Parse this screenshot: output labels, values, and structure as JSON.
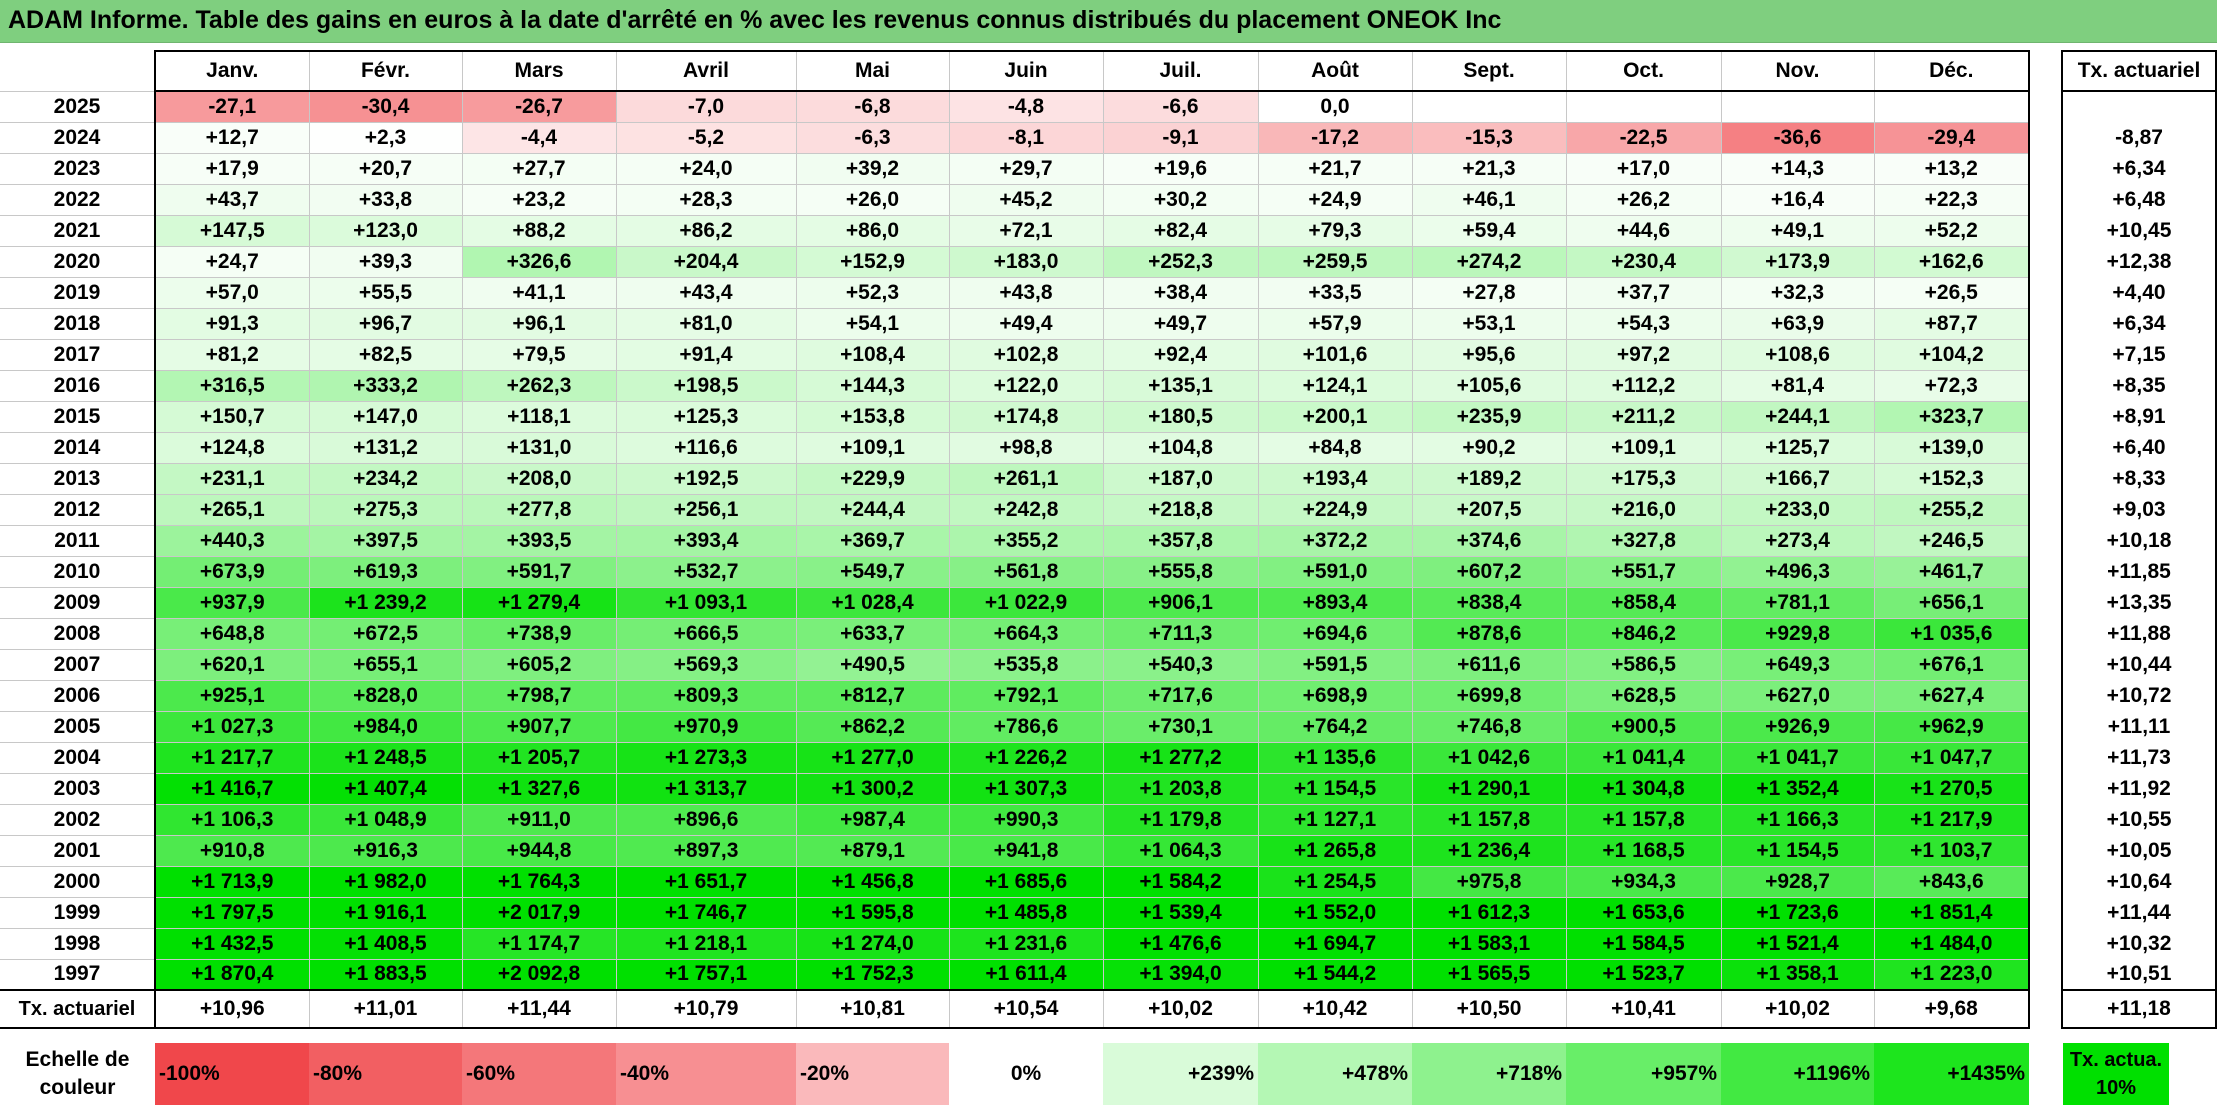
{
  "title": "ADAM Informe. Table des gains en euros à la date d'arrêté en % avec les revenus connus distribués du placement ONEOK Inc",
  "months": [
    "Janv.",
    "Févr.",
    "Mars",
    "Avril",
    "Mai",
    "Juin",
    "Juil.",
    "Août",
    "Sept.",
    "Oct.",
    "Nov.",
    "Déc."
  ],
  "tx_header": "Tx. actuariel",
  "rows": [
    {
      "year": "2025",
      "cells": [
        "-27,1",
        "-30,4",
        "-26,7",
        "-7,0",
        "-6,8",
        "-4,8",
        "-6,6",
        "0,0",
        "",
        "",
        "",
        ""
      ],
      "tx": ""
    },
    {
      "year": "2024",
      "cells": [
        "+12,7",
        "+2,3",
        "-4,4",
        "-5,2",
        "-6,3",
        "-8,1",
        "-9,1",
        "-17,2",
        "-15,3",
        "-22,5",
        "-36,6",
        "-29,4"
      ],
      "tx": "-8,87"
    },
    {
      "year": "2023",
      "cells": [
        "+17,9",
        "+20,7",
        "+27,7",
        "+24,0",
        "+39,2",
        "+29,7",
        "+19,6",
        "+21,7",
        "+21,3",
        "+17,0",
        "+14,3",
        "+13,2"
      ],
      "tx": "+6,34"
    },
    {
      "year": "2022",
      "cells": [
        "+43,7",
        "+33,8",
        "+23,2",
        "+28,3",
        "+26,0",
        "+45,2",
        "+30,2",
        "+24,9",
        "+46,1",
        "+26,2",
        "+16,4",
        "+22,3"
      ],
      "tx": "+6,48"
    },
    {
      "year": "2021",
      "cells": [
        "+147,5",
        "+123,0",
        "+88,2",
        "+86,2",
        "+86,0",
        "+72,1",
        "+82,4",
        "+79,3",
        "+59,4",
        "+44,6",
        "+49,1",
        "+52,2"
      ],
      "tx": "+10,45"
    },
    {
      "year": "2020",
      "cells": [
        "+24,7",
        "+39,3",
        "+326,6",
        "+204,4",
        "+152,9",
        "+183,0",
        "+252,3",
        "+259,5",
        "+274,2",
        "+230,4",
        "+173,9",
        "+162,6"
      ],
      "tx": "+12,38"
    },
    {
      "year": "2019",
      "cells": [
        "+57,0",
        "+55,5",
        "+41,1",
        "+43,4",
        "+52,3",
        "+43,8",
        "+38,4",
        "+33,5",
        "+27,8",
        "+37,7",
        "+32,3",
        "+26,5"
      ],
      "tx": "+4,40"
    },
    {
      "year": "2018",
      "cells": [
        "+91,3",
        "+96,7",
        "+96,1",
        "+81,0",
        "+54,1",
        "+49,4",
        "+49,7",
        "+57,9",
        "+53,1",
        "+54,3",
        "+63,9",
        "+87,7"
      ],
      "tx": "+6,34"
    },
    {
      "year": "2017",
      "cells": [
        "+81,2",
        "+82,5",
        "+79,5",
        "+91,4",
        "+108,4",
        "+102,8",
        "+92,4",
        "+101,6",
        "+95,6",
        "+97,2",
        "+108,6",
        "+104,2"
      ],
      "tx": "+7,15"
    },
    {
      "year": "2016",
      "cells": [
        "+316,5",
        "+333,2",
        "+262,3",
        "+198,5",
        "+144,3",
        "+122,0",
        "+135,1",
        "+124,1",
        "+105,6",
        "+112,2",
        "+81,4",
        "+72,3"
      ],
      "tx": "+8,35"
    },
    {
      "year": "2015",
      "cells": [
        "+150,7",
        "+147,0",
        "+118,1",
        "+125,3",
        "+153,8",
        "+174,8",
        "+180,5",
        "+200,1",
        "+235,9",
        "+211,2",
        "+244,1",
        "+323,7"
      ],
      "tx": "+8,91"
    },
    {
      "year": "2014",
      "cells": [
        "+124,8",
        "+131,2",
        "+131,0",
        "+116,6",
        "+109,1",
        "+98,8",
        "+104,8",
        "+84,8",
        "+90,2",
        "+109,1",
        "+125,7",
        "+139,0"
      ],
      "tx": "+6,40"
    },
    {
      "year": "2013",
      "cells": [
        "+231,1",
        "+234,2",
        "+208,0",
        "+192,5",
        "+229,9",
        "+261,1",
        "+187,0",
        "+193,4",
        "+189,2",
        "+175,3",
        "+166,7",
        "+152,3"
      ],
      "tx": "+8,33"
    },
    {
      "year": "2012",
      "cells": [
        "+265,1",
        "+275,3",
        "+277,8",
        "+256,1",
        "+244,4",
        "+242,8",
        "+218,8",
        "+224,9",
        "+207,5",
        "+216,0",
        "+233,0",
        "+255,2"
      ],
      "tx": "+9,03"
    },
    {
      "year": "2011",
      "cells": [
        "+440,3",
        "+397,5",
        "+393,5",
        "+393,4",
        "+369,7",
        "+355,2",
        "+357,8",
        "+372,2",
        "+374,6",
        "+327,8",
        "+273,4",
        "+246,5"
      ],
      "tx": "+10,18"
    },
    {
      "year": "2010",
      "cells": [
        "+673,9",
        "+619,3",
        "+591,7",
        "+532,7",
        "+549,7",
        "+561,8",
        "+555,8",
        "+591,0",
        "+607,2",
        "+551,7",
        "+496,3",
        "+461,7"
      ],
      "tx": "+11,85"
    },
    {
      "year": "2009",
      "cells": [
        "+937,9",
        "+1 239,2",
        "+1 279,4",
        "+1 093,1",
        "+1 028,4",
        "+1 022,9",
        "+906,1",
        "+893,4",
        "+838,4",
        "+858,4",
        "+781,1",
        "+656,1"
      ],
      "tx": "+13,35"
    },
    {
      "year": "2008",
      "cells": [
        "+648,8",
        "+672,5",
        "+738,9",
        "+666,5",
        "+633,7",
        "+664,3",
        "+711,3",
        "+694,6",
        "+878,6",
        "+846,2",
        "+929,8",
        "+1 035,6"
      ],
      "tx": "+11,88"
    },
    {
      "year": "2007",
      "cells": [
        "+620,1",
        "+655,1",
        "+605,2",
        "+569,3",
        "+490,5",
        "+535,8",
        "+540,3",
        "+591,5",
        "+611,6",
        "+586,5",
        "+649,3",
        "+676,1"
      ],
      "tx": "+10,44"
    },
    {
      "year": "2006",
      "cells": [
        "+925,1",
        "+828,0",
        "+798,7",
        "+809,3",
        "+812,7",
        "+792,1",
        "+717,6",
        "+698,9",
        "+699,8",
        "+628,5",
        "+627,0",
        "+627,4"
      ],
      "tx": "+10,72"
    },
    {
      "year": "2005",
      "cells": [
        "+1 027,3",
        "+984,0",
        "+907,7",
        "+970,9",
        "+862,2",
        "+786,6",
        "+730,1",
        "+764,2",
        "+746,8",
        "+900,5",
        "+926,9",
        "+962,9"
      ],
      "tx": "+11,11"
    },
    {
      "year": "2004",
      "cells": [
        "+1 217,7",
        "+1 248,5",
        "+1 205,7",
        "+1 273,3",
        "+1 277,0",
        "+1 226,2",
        "+1 277,2",
        "+1 135,6",
        "+1 042,6",
        "+1 041,4",
        "+1 041,7",
        "+1 047,7"
      ],
      "tx": "+11,73"
    },
    {
      "year": "2003",
      "cells": [
        "+1 416,7",
        "+1 407,4",
        "+1 327,6",
        "+1 313,7",
        "+1 300,2",
        "+1 307,3",
        "+1 203,8",
        "+1 154,5",
        "+1 290,1",
        "+1 304,8",
        "+1 352,4",
        "+1 270,5"
      ],
      "tx": "+11,92"
    },
    {
      "year": "2002",
      "cells": [
        "+1 106,3",
        "+1 048,9",
        "+911,0",
        "+896,6",
        "+987,4",
        "+990,3",
        "+1 179,8",
        "+1 127,1",
        "+1 157,8",
        "+1 157,8",
        "+1 166,3",
        "+1 217,9"
      ],
      "tx": "+10,55"
    },
    {
      "year": "2001",
      "cells": [
        "+910,8",
        "+916,3",
        "+944,8",
        "+897,3",
        "+879,1",
        "+941,8",
        "+1 064,3",
        "+1 265,8",
        "+1 236,4",
        "+1 168,5",
        "+1 154,5",
        "+1 103,7"
      ],
      "tx": "+10,05"
    },
    {
      "year": "2000",
      "cells": [
        "+1 713,9",
        "+1 982,0",
        "+1 764,3",
        "+1 651,7",
        "+1 456,8",
        "+1 685,6",
        "+1 584,2",
        "+1 254,5",
        "+975,8",
        "+934,3",
        "+928,7",
        "+843,6"
      ],
      "tx": "+10,64"
    },
    {
      "year": "1999",
      "cells": [
        "+1 797,5",
        "+1 916,1",
        "+2 017,9",
        "+1 746,7",
        "+1 595,8",
        "+1 485,8",
        "+1 539,4",
        "+1 552,0",
        "+1 612,3",
        "+1 653,6",
        "+1 723,6",
        "+1 851,4"
      ],
      "tx": "+11,44"
    },
    {
      "year": "1998",
      "cells": [
        "+1 432,5",
        "+1 408,5",
        "+1 174,7",
        "+1 218,1",
        "+1 274,0",
        "+1 231,6",
        "+1 476,6",
        "+1 694,7",
        "+1 583,1",
        "+1 584,5",
        "+1 521,4",
        "+1 484,0"
      ],
      "tx": "+10,32"
    },
    {
      "year": "1997",
      "cells": [
        "+1 870,4",
        "+1 883,5",
        "+2 092,8",
        "+1 757,1",
        "+1 752,3",
        "+1 611,4",
        "+1 394,0",
        "+1 544,2",
        "+1 565,5",
        "+1 523,7",
        "+1 358,1",
        "+1 223,0"
      ],
      "tx": "+10,51"
    }
  ],
  "footer": {
    "label": "Tx. actuariel",
    "cells": [
      "+10,96",
      "+11,01",
      "+11,44",
      "+10,79",
      "+10,81",
      "+10,54",
      "+10,02",
      "+10,42",
      "+10,50",
      "+10,41",
      "+10,02",
      "+9,68"
    ],
    "tx": "+11,18"
  },
  "legend": {
    "label": "Echelle de couleur",
    "items": [
      {
        "text": "-100%",
        "color": "#f0474b"
      },
      {
        "text": "-80%",
        "color": "#f25f62"
      },
      {
        "text": "-60%",
        "color": "#f4777a"
      },
      {
        "text": "-40%",
        "color": "#f78f92"
      },
      {
        "text": "-20%",
        "color": "#fab9bb"
      },
      {
        "text": "0%",
        "color": "#ffffff"
      },
      {
        "text": "+239%",
        "color": "#d9fbd9"
      },
      {
        "text": "+478%",
        "color": "#b4f7b4"
      },
      {
        "text": "+718%",
        "color": "#8ef28e"
      },
      {
        "text": "+957%",
        "color": "#68ee68"
      },
      {
        "text": "+1196%",
        "color": "#42e942"
      },
      {
        "text": "+1435%",
        "color": "#1de51d"
      }
    ],
    "tx_label": "Tx. actua. 10%",
    "tx_color": "#00e000"
  },
  "colors": {
    "title_bar": "#7fcf7f",
    "negative_max": "#f0474b",
    "positive_max": "#00e000"
  }
}
